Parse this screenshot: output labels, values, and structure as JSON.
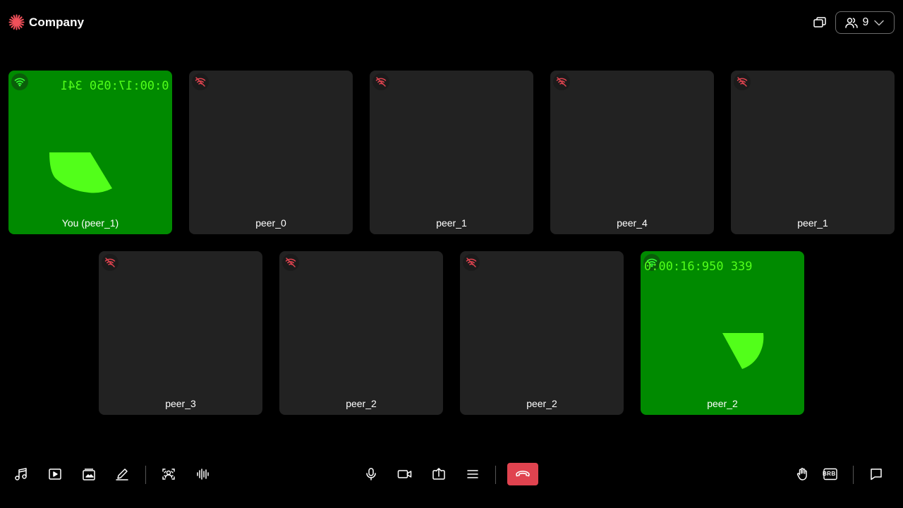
{
  "app": {
    "brand_name": "Company",
    "brand_color": "#f0505a"
  },
  "header": {
    "participant_count": "9",
    "icons": [
      "pip-icon",
      "participants-icon",
      "chevron-down-icon"
    ]
  },
  "tiles": [
    {
      "name": "You (peer_1)",
      "video": true,
      "network": "good",
      "timecode": "0:00:17:050 341",
      "timecode_mirrored": true
    },
    {
      "name": "peer_0",
      "video": false,
      "network": "poor"
    },
    {
      "name": "peer_1",
      "video": false,
      "network": "poor"
    },
    {
      "name": "peer_4",
      "video": false,
      "network": "poor"
    },
    {
      "name": "peer_1",
      "video": false,
      "network": "poor"
    },
    {
      "name": "peer_3",
      "video": false,
      "network": "poor"
    },
    {
      "name": "peer_2",
      "video": false,
      "network": "poor"
    },
    {
      "name": "peer_2",
      "video": false,
      "network": "poor"
    },
    {
      "name": "peer_2",
      "video": true,
      "network": "good",
      "timecode": "0:00:16:950 339",
      "timecode_mirrored": false
    }
  ],
  "colors": {
    "tile_bg": "#222222",
    "video_bg": "#008a00",
    "video_shape": "#52ff1a",
    "network_good": "#33ff33",
    "network_poor": "#e0434f",
    "leave_button": "#e0434f"
  },
  "toolbar": {
    "left_icons": [
      "music-icon",
      "play-video-icon",
      "media-gallery-icon",
      "whiteboard-pen-icon",
      "background-effects-icon",
      "audio-waveform-icon"
    ],
    "center_icons": [
      "microphone-icon",
      "camera-icon",
      "screen-share-icon",
      "more-menu-icon",
      "leave-call-icon"
    ],
    "right_icons": [
      "raise-hand-icon",
      "brb-icon",
      "chat-icon"
    ],
    "brb_label": "BRB"
  }
}
